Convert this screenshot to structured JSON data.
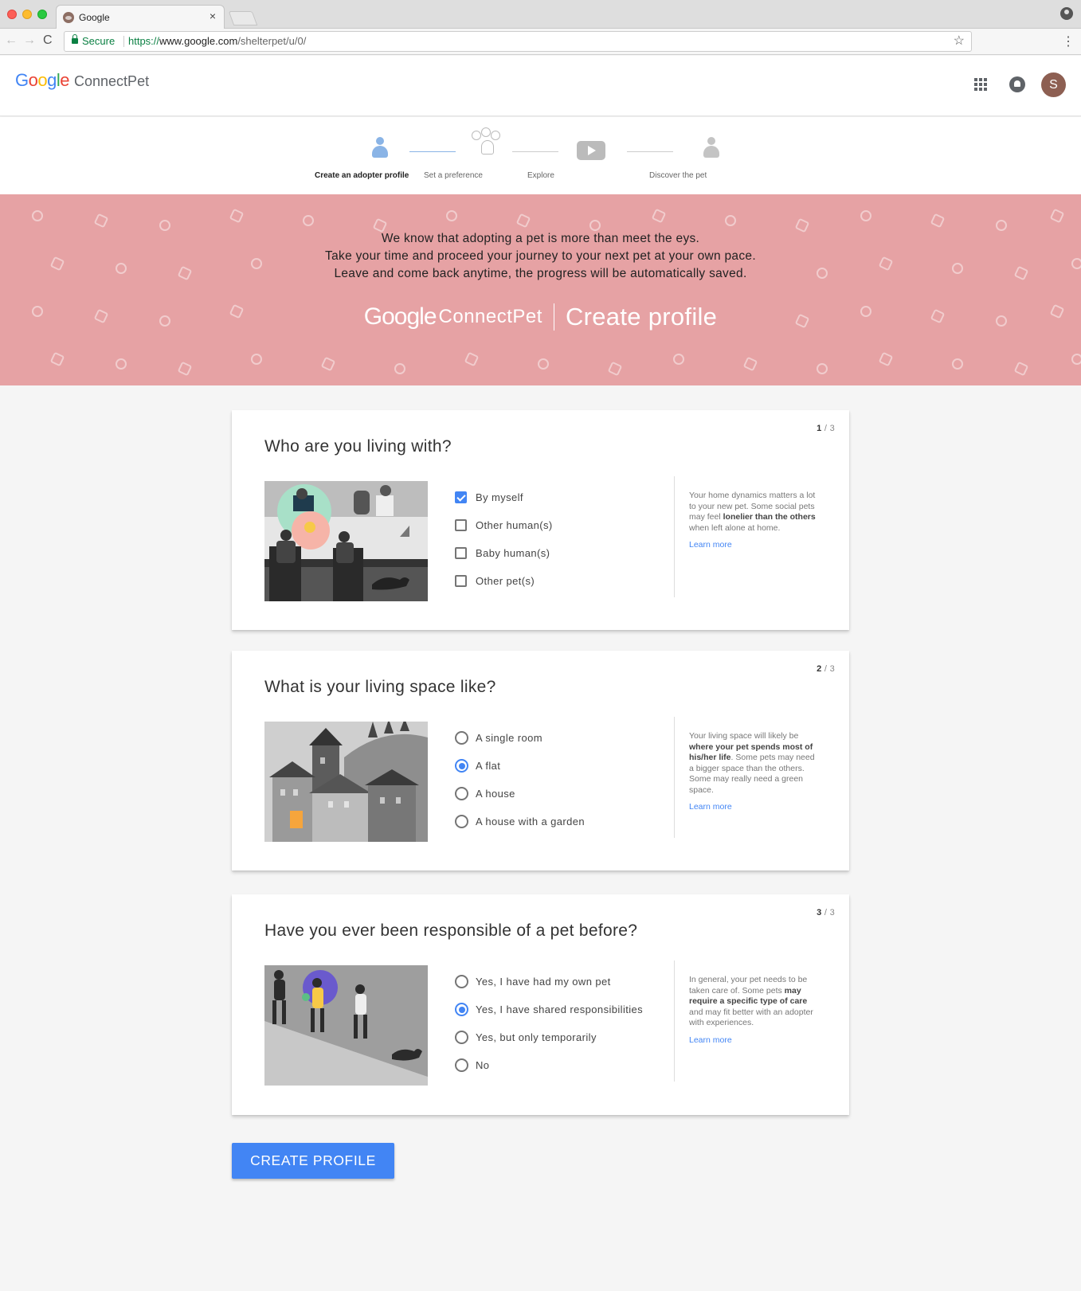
{
  "browser": {
    "tab_title": "Google",
    "tab_close": "×",
    "secure_label": "Secure",
    "url_scheme": "https://",
    "url_host": "www.google.com",
    "url_path": "/shelterpet/u/0/",
    "nav_back": "←",
    "nav_forward": "→",
    "nav_reload": "C",
    "star": "☆",
    "menu": "⋮"
  },
  "header": {
    "logo_letters": [
      "G",
      "o",
      "o",
      "g",
      "l",
      "e"
    ],
    "product_name": "ConnectPet",
    "avatar_initial": "S",
    "icons": [
      "apps-grid-icon",
      "notifications-icon"
    ]
  },
  "stepper": {
    "steps": [
      {
        "label": "Create an adopter profile",
        "icon": "person-icon",
        "active": true
      },
      {
        "label": "Set a preference",
        "icon": "balloons-icon",
        "active": false
      },
      {
        "label": "Explore",
        "icon": "play-icon",
        "active": false
      },
      {
        "label": "Discover the pet",
        "icon": "person-icon",
        "active": false
      }
    ]
  },
  "banner": {
    "line1": "We know that adopting a pet is more than meet the eys.",
    "line2": "Take your time and proceed your journey to your next pet at your own pace.",
    "line3": "Leave and come back anytime, the progress will be automatically saved.",
    "brand_google": "Google",
    "brand_product": "ConnectPet",
    "page_title": "Create profile",
    "background_color": "#e6a2a4"
  },
  "cards": [
    {
      "counter_current": "1",
      "counter_total": "/ 3",
      "title": "Who are you living with?",
      "input_type": "checkbox",
      "options": [
        {
          "label": "By myself",
          "checked": true
        },
        {
          "label": "Other human(s)",
          "checked": false
        },
        {
          "label": "Baby human(s)",
          "checked": false
        },
        {
          "label": "Other pet(s)",
          "checked": false
        }
      ],
      "info_parts": [
        "Your home dynamics matters a lot to your new pet. Some social pets may feel ",
        "lonelier than the others",
        " when left alone at home."
      ],
      "learn_more": "Learn more"
    },
    {
      "counter_current": "2",
      "counter_total": "/ 3",
      "title": "What is your living space like?",
      "input_type": "radio",
      "options": [
        {
          "label": "A single room",
          "checked": false
        },
        {
          "label": "A flat",
          "checked": true
        },
        {
          "label": "A house",
          "checked": false
        },
        {
          "label": "A house with a garden",
          "checked": false
        }
      ],
      "info_parts": [
        "Your living space will likely be ",
        "where your pet spends most of his/her life",
        ". Some pets may need a bigger space than the others. Some may really need a green space."
      ],
      "learn_more": "Learn more"
    },
    {
      "counter_current": "3",
      "counter_total": "/ 3",
      "title": "Have you ever been responsible of a pet before?",
      "input_type": "radio",
      "options": [
        {
          "label": "Yes, I have had my own pet",
          "checked": false
        },
        {
          "label": "Yes, I have shared responsibilities",
          "checked": true
        },
        {
          "label": "Yes, but only temporarily",
          "checked": false
        },
        {
          "label": "No",
          "checked": false
        }
      ],
      "info_parts": [
        "In general, your pet needs to be taken care of. Some pets ",
        "may require a specific type of care",
        " and may fit better with an adopter with experiences."
      ],
      "learn_more": "Learn more"
    }
  ],
  "submit_label": "CREATE PROFILE",
  "colors": {
    "accent": "#4285f4",
    "banner": "#e6a2a4"
  }
}
